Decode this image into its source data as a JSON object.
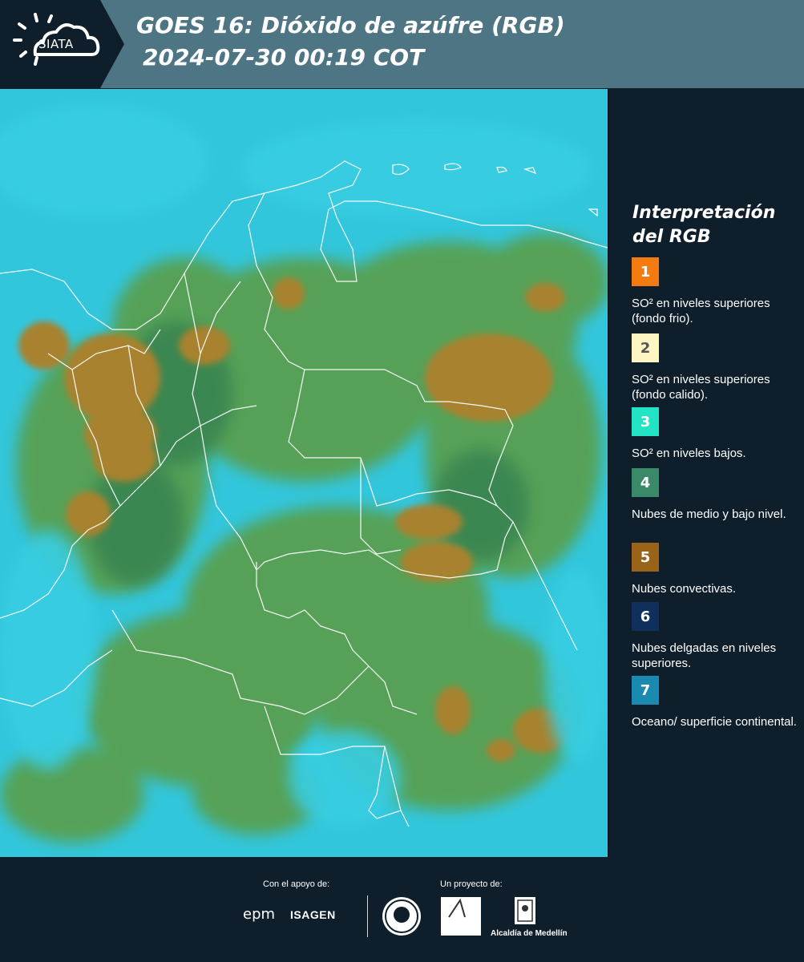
{
  "header": {
    "logo_text": "SIATA",
    "title_line1": "GOES 16: Dióxido de azúfre (RGB)",
    "title_line2": "2024-07-30 00:19 COT"
  },
  "legend": {
    "title": "Interpretación del RGB",
    "items": [
      {
        "number": "1",
        "color": "#f47a12",
        "text": "SO² en niveles superiores (fondo frio)."
      },
      {
        "number": "2",
        "color": "#fdf6c2",
        "text": "SO² en niveles superiores (fondo calido)."
      },
      {
        "number": "3",
        "color": "#22e3c3",
        "text": "SO² en niveles bajos."
      },
      {
        "number": "4",
        "color": "#3a8a6a",
        "text": "Nubes de medio y bajo nivel."
      },
      {
        "number": "5",
        "color": "#9a6418",
        "text": "Nubes convectivas."
      },
      {
        "number": "6",
        "color": "#0f2f5c",
        "text": "Nubes delgadas en niveles superiores."
      },
      {
        "number": "7",
        "color": "#1a8ab0",
        "text": "Oceano/ superficie continental."
      }
    ]
  },
  "footer": {
    "support_label": "Con el apoyo de:",
    "project_label": "Un proyecto de:",
    "epm": "epm",
    "isagen": "ISAGEN",
    "area_logo": "Área Metropolitana Valle de Aburrá",
    "alcaldia": "Alcaldía de Medellín"
  },
  "colors": {
    "background": "#0e1e2b",
    "header": "#4e7584",
    "ocean_cyan": "#32c6dc",
    "land_green": "#5ea24a",
    "convective_brown": "#a8822e"
  }
}
